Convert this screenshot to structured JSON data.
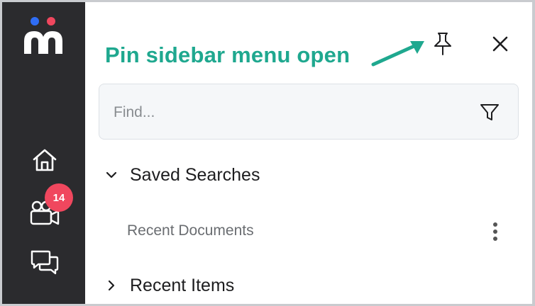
{
  "annotation": {
    "text": "Pin sidebar menu open",
    "color": "#1fa88f"
  },
  "header": {
    "pin_icon": "pin-icon",
    "close_icon": "close-icon"
  },
  "rail": {
    "logo": "mojo-logo",
    "items": [
      {
        "icon": "home-icon"
      },
      {
        "icon": "video-camera-icon",
        "badge": "14"
      },
      {
        "icon": "chat-bubbles-icon"
      }
    ],
    "badge_color": "#f0475e"
  },
  "search": {
    "placeholder": "Find...",
    "value": "",
    "filter_icon": "filter-icon"
  },
  "sections": [
    {
      "label": "Saved Searches",
      "expanded": true,
      "items": [
        {
          "label": "Recent Documents",
          "menu_icon": "more-vertical-icon"
        }
      ]
    },
    {
      "label": "Recent Items",
      "expanded": false
    }
  ]
}
